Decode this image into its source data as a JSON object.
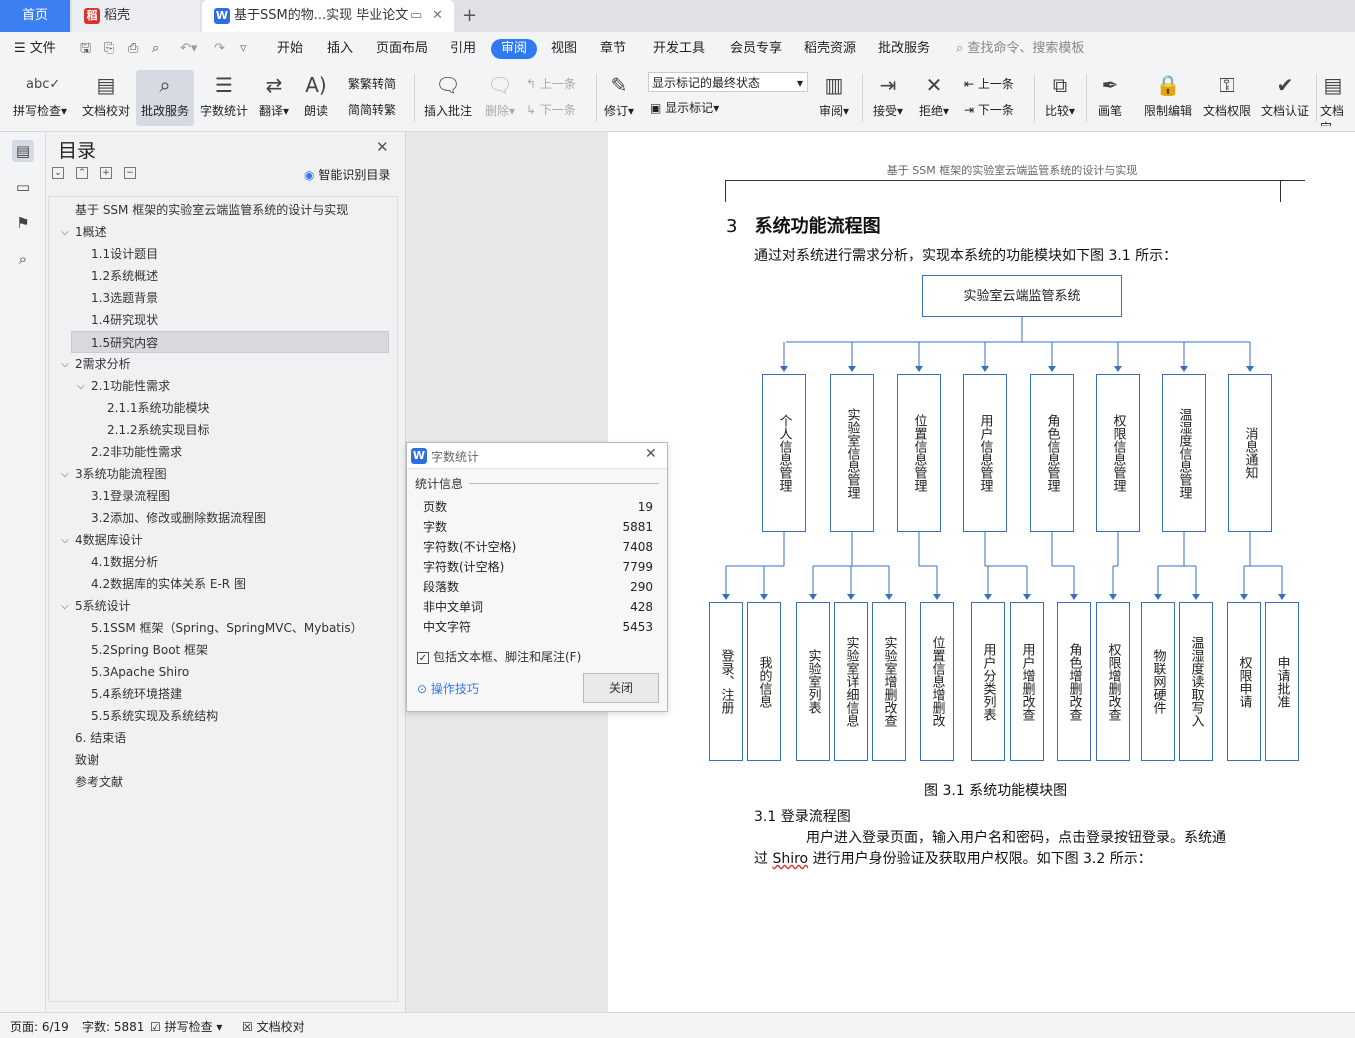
{
  "tabs": {
    "home": "首页",
    "daoke": "稻壳",
    "doc": "基于SSM的物...实现 毕业论文"
  },
  "menu": {
    "file": "文件",
    "items": [
      "开始",
      "插入",
      "页面布局",
      "引用",
      "审阅",
      "视图",
      "章节",
      "开发工具",
      "会员专享",
      "稻壳资源",
      "批改服务"
    ],
    "search_placeholder": "查找命令、搜索模板"
  },
  "ribbon": {
    "spell": "拼写检查",
    "proof": "文档校对",
    "correct": "批改服务",
    "wordcount": "字数统计",
    "translate": "翻译",
    "read": "朗读",
    "trad": "繁转简",
    "simp": "简转繁",
    "insert_comment": "插入批注",
    "delete": "删除",
    "prev": "上一条",
    "next": "下一条",
    "track": "修订",
    "markup_state": "显示标记的最终状态",
    "show_markup": "显示标记",
    "review": "审阅",
    "accept": "接受",
    "reject": "拒绝",
    "prev2": "上一条",
    "next2": "下一条",
    "compare": "比较",
    "pen": "画笔",
    "restrict": "限制编辑",
    "doc_rights": "文档权限",
    "doc_cert": "文档认证",
    "doc_fixed": "文档定"
  },
  "toc": {
    "title": "目录",
    "smart": "智能识别目录",
    "items": [
      "基于 SSM 框架的实验室云端监管系统的设计与实现",
      "1概述",
      "1.1设计题目",
      "1.2系统概述",
      "1.3选题背景",
      "1.4研究现状",
      "1.5研究内容",
      "2需求分析",
      "2.1功能性需求",
      "2.1.1系统功能模块",
      "2.1.2系统实现目标",
      "2.2非功能性需求",
      "3系统功能流程图",
      "3.1登录流程图",
      "3.2添加、修改或删除数据流程图",
      "4数据库设计",
      "4.1数据分析",
      "4.2数据库的实体关系 E-R 图",
      "5系统设计",
      "5.1SSM 框架（Spring、SpringMVC、Mybatis）",
      "5.2Spring Boot 框架",
      "5.3Apache Shiro",
      "5.4系统环境搭建",
      "5.5系统实现及系统结构",
      "6. 结束语",
      "致谢",
      "参考文献"
    ]
  },
  "document": {
    "header": "基于 SSM 框架的实验室云端监管系统的设计与实现",
    "section_num": "3",
    "section_title": "系统功能流程图",
    "intro": "通过对系统进行需求分析，实现本系统的功能模块如下图 3.1 所示：",
    "figure_caption": "图 3.1 系统功能模块图",
    "subsection": "3.1  登录流程图",
    "para1": "用户进入登录页面，输入用户名和密码，点击登录按钮登录。系统通",
    "para2_a": "过 ",
    "para2_shiro": "Shiro",
    "para2_b": " 进行用户身份验证及获取用户权限。如下图 3.2 所示："
  },
  "diagram": {
    "root": "实验室云端监管系统",
    "level1": [
      "个人信息管理",
      "实验室信息管理",
      "位置信息管理",
      "用户信息管理",
      "角色信息管理",
      "权限信息管理",
      "温湿度信息管理",
      "消息通知"
    ],
    "level2": [
      "登录、注册",
      "我的信息",
      "实验室列表",
      "实验室详细信息",
      "实验室增删改查",
      "位置信息增删改",
      "用户分类列表",
      "用户增删改查",
      "角色增删改查",
      "权限增删改查",
      "物联网硬件",
      "温湿度读取写入",
      "权限申请",
      "申请批准"
    ]
  },
  "dialog": {
    "title": "字数统计",
    "section": "统计信息",
    "rows": [
      {
        "label": "页数",
        "value": "19"
      },
      {
        "label": "字数",
        "value": "5881"
      },
      {
        "label": "字符数(不计空格)",
        "value": "7408"
      },
      {
        "label": "字符数(计空格)",
        "value": "7799"
      },
      {
        "label": "段落数",
        "value": "290"
      },
      {
        "label": "非中文单词",
        "value": "428"
      },
      {
        "label": "中文字符",
        "value": "5453"
      }
    ],
    "checkbox": "包括文本框、脚注和尾注(F)",
    "tips": "操作技巧",
    "close": "关闭"
  },
  "status": {
    "page": "页面: 6/19",
    "words": "字数: 5881",
    "spell": "拼写检查",
    "proof": "文档校对"
  },
  "colors": {
    "accent": "#2f7af0",
    "box_border": "#3a6fbf",
    "wps_red": "#d9312b",
    "wps_blue": "#2e6fe0"
  }
}
